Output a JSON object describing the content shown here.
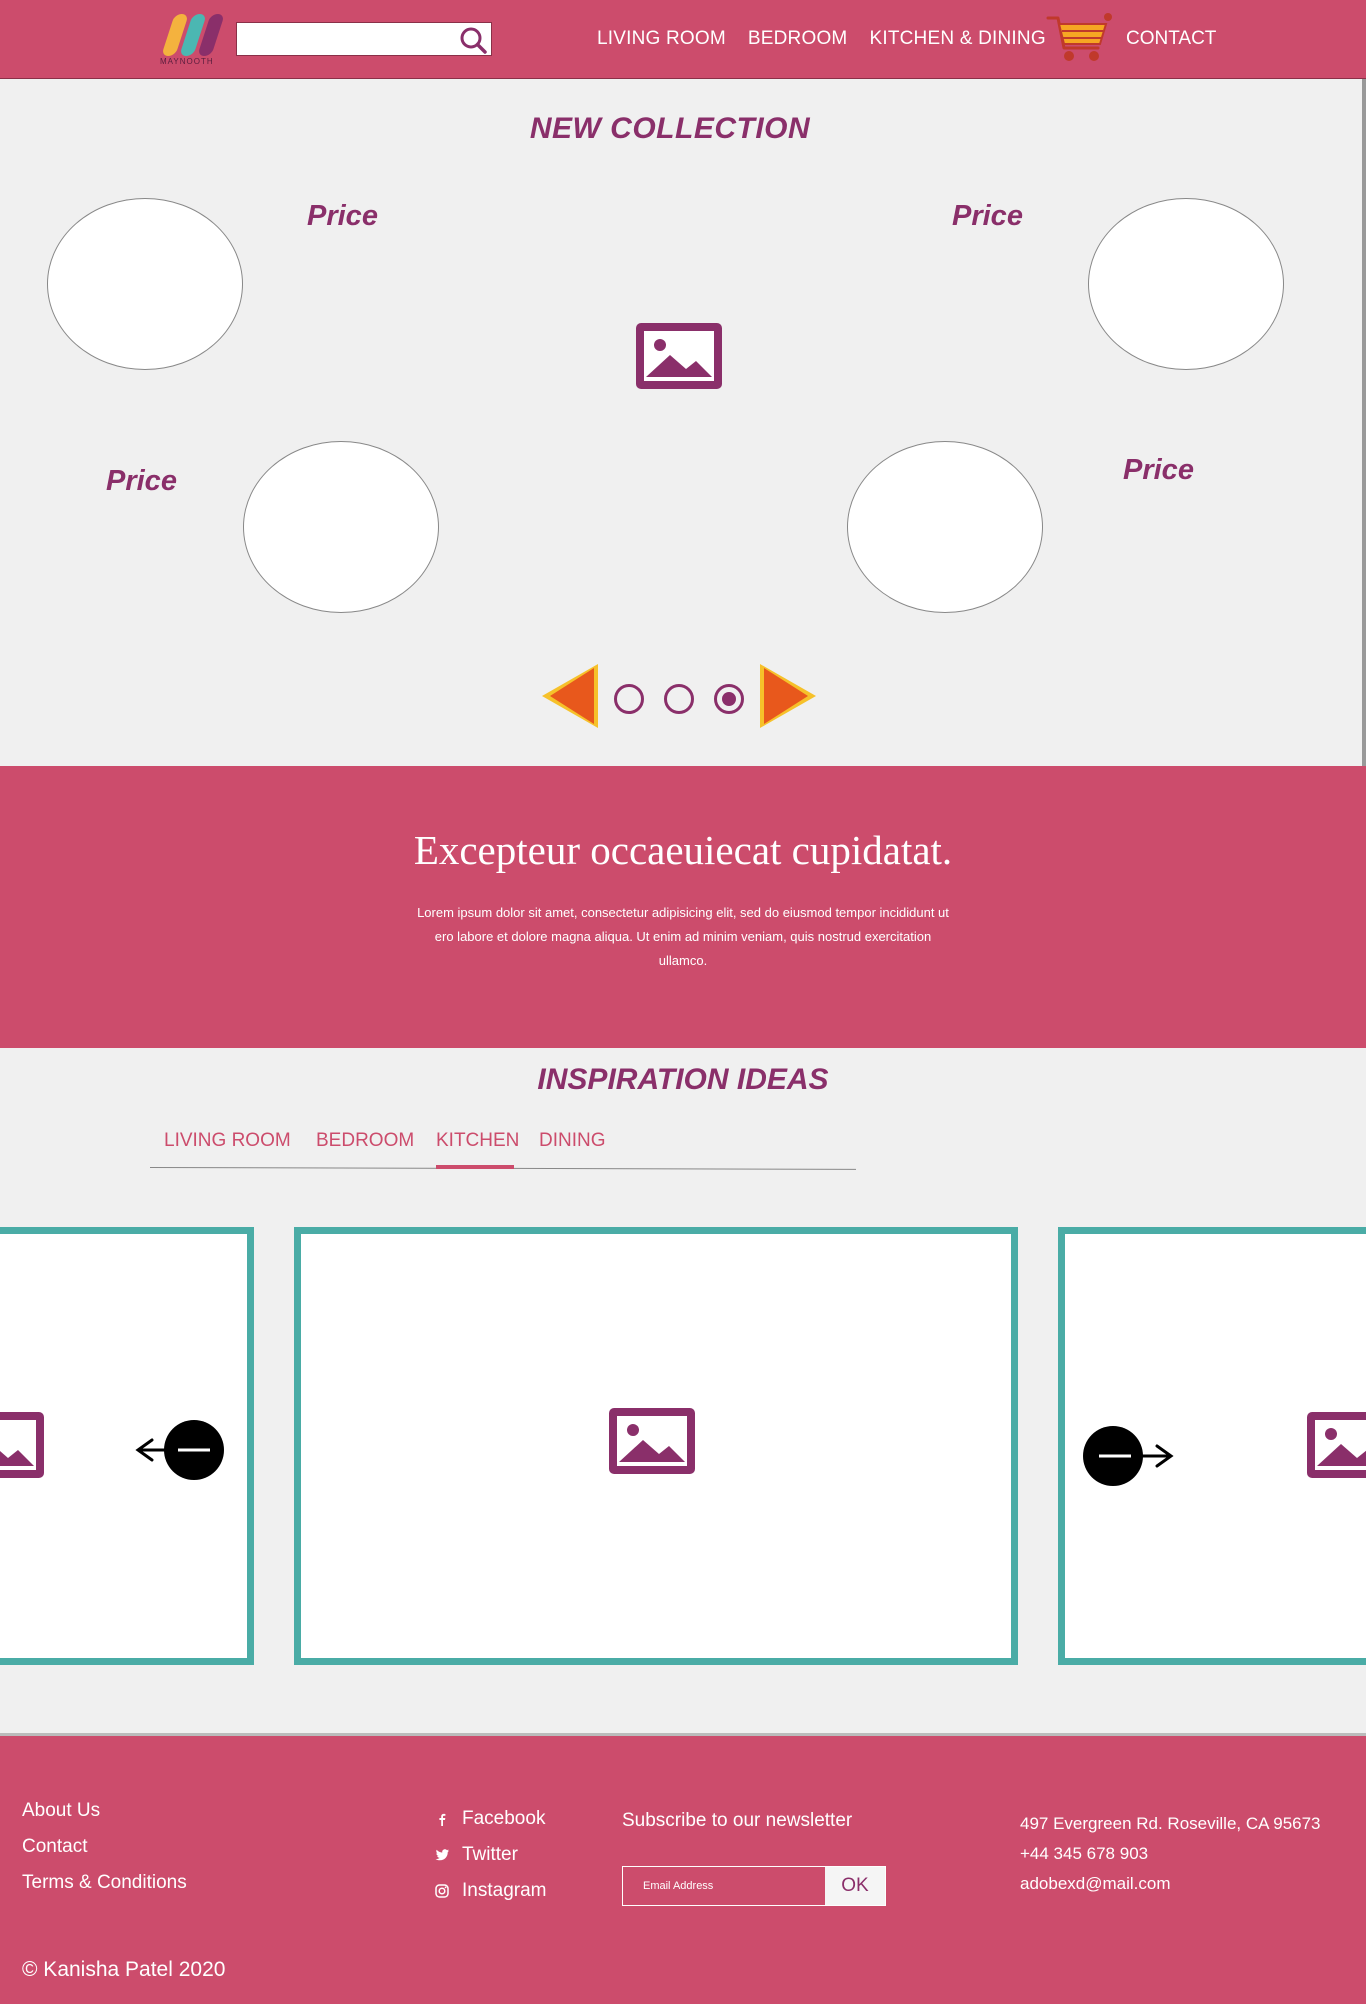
{
  "header": {
    "logo_text": "MAYNOOTH",
    "search": {
      "value": "",
      "placeholder": ""
    },
    "nav": [
      "LIVING ROOM",
      "BEDROOM",
      "KITCHEN & DINING"
    ],
    "contact": "CONTACT",
    "icons": {
      "search": "search-icon",
      "cart": "shopping-cart-icon"
    }
  },
  "collection": {
    "title": "NEW COLLECTION",
    "price_labels": [
      "Price",
      "Price",
      "Price",
      "Price"
    ],
    "active_slide": 3,
    "slide_count": 3
  },
  "banner": {
    "title": "Excepteur occaeuiecat cupidatat.",
    "body": "Lorem ipsum dolor sit amet, consectetur adipisicing elit, sed do eiusmod tempor incididunt ut ero labore et dolore magna aliqua. Ut enim ad minim veniam, quis nostrud exercitation ullamco."
  },
  "inspiration": {
    "title": "INSPIRATION IDEAS",
    "tabs": [
      "LIVING ROOM",
      "BEDROOM",
      "KITCHEN",
      "DINING"
    ],
    "active_tab": "KITCHEN"
  },
  "footer": {
    "links": [
      "About Us",
      "Contact",
      "Terms & Conditions"
    ],
    "social": [
      "Facebook",
      "Twitter",
      "Instagram"
    ],
    "newsletter": {
      "title": "Subscribe to our newsletter",
      "placeholder": "Email Address",
      "button": "OK"
    },
    "address": "497 Evergreen Rd. Roseville, CA 95673",
    "phone": "+44 345 678 903",
    "email": "adobexd@mail.com",
    "copyright": "© Kanisha Patel 2020"
  },
  "colors": {
    "brand_pink": "#cc4c6c",
    "accent_purple": "#8a2f6a",
    "teal_border": "#4aaca6",
    "background": "#f0f0f0"
  }
}
